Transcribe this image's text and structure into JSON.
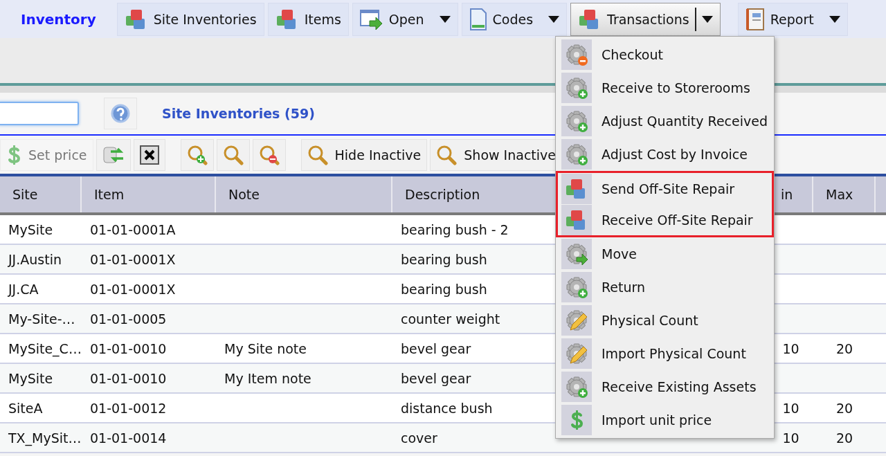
{
  "app_title": "Inventory",
  "nav": [
    {
      "label": "Site Inventories",
      "kind": "blocks",
      "dropdown": false,
      "open": false
    },
    {
      "label": "Items",
      "kind": "blocks",
      "dropdown": false,
      "open": false
    },
    {
      "label": "Open",
      "kind": "window-arrow",
      "dropdown": true,
      "open": false
    },
    {
      "label": "Codes",
      "kind": "page",
      "dropdown": true,
      "open": false
    },
    {
      "label": "Transactions",
      "kind": "blocks",
      "dropdown": true,
      "open": true
    },
    {
      "label": "Report",
      "kind": "notebook",
      "dropdown": true,
      "open": false
    }
  ],
  "menu": [
    {
      "label": "Checkout",
      "kind": "gear-minus",
      "highlighted": false
    },
    {
      "label": "Receive to Storerooms",
      "kind": "gear-plus",
      "highlighted": false
    },
    {
      "label": "Adjust Quantity Received",
      "kind": "gear-plus",
      "highlighted": false
    },
    {
      "label": "Adjust Cost by Invoice",
      "kind": "gear-plus",
      "highlighted": false
    },
    {
      "label": "Send Off-Site Repair",
      "kind": "blocks",
      "highlighted": true
    },
    {
      "label": "Receive Off-Site Repair",
      "kind": "blocks",
      "highlighted": true
    },
    {
      "label": "Move",
      "kind": "gear-arrow",
      "highlighted": false
    },
    {
      "label": "Return",
      "kind": "gear-plus",
      "highlighted": false
    },
    {
      "label": "Physical Count",
      "kind": "gear-pencil",
      "highlighted": false
    },
    {
      "label": "Import Physical Count",
      "kind": "gear-pencil",
      "highlighted": false
    },
    {
      "label": "Receive Existing Assets",
      "kind": "gear-plus",
      "highlighted": false
    },
    {
      "label": "Import unit price",
      "kind": "dollar",
      "highlighted": false
    }
  ],
  "list_title": "Site Inventories (59)",
  "toolbar_groups": [
    {
      "buttons": [
        {
          "kind": "dollar",
          "label": "Set price",
          "disabled": true
        },
        {
          "kind": "refresh",
          "disabled": false
        },
        {
          "kind": "close-box",
          "disabled": false
        }
      ]
    },
    {
      "buttons": [
        {
          "kind": "zoom-plus",
          "disabled": false
        },
        {
          "kind": "zoom",
          "disabled": false
        },
        {
          "kind": "zoom-minus",
          "disabled": false
        }
      ]
    },
    {
      "buttons": [
        {
          "kind": "zoom",
          "label": "Hide Inactive",
          "disabled": false
        },
        {
          "kind": "zoom",
          "label": "Show Inactive",
          "disabled": false
        }
      ]
    }
  ],
  "table": {
    "columns": [
      "Site",
      "Item",
      "Note",
      "Description",
      "in",
      "Max"
    ],
    "rows": [
      [
        "MySite",
        "01-01-0001A",
        "",
        "bearing bush - 2",
        "",
        ""
      ],
      [
        "JJ.Austin",
        "01-01-0001X",
        "",
        "bearing bush",
        "",
        ""
      ],
      [
        "JJ.CA",
        "01-01-0001X",
        "",
        "bearing bush",
        "",
        ""
      ],
      [
        "My-Site-…",
        "01-01-0005",
        "",
        "counter weight",
        "",
        ""
      ],
      [
        "MySite_C…",
        "01-01-0010",
        "My Site note",
        "bevel gear",
        "10",
        "20"
      ],
      [
        "MySite",
        "01-01-0010",
        "My Item note",
        "bevel gear",
        "",
        ""
      ],
      [
        "SiteA",
        "01-01-0012",
        "",
        "distance bush",
        "10",
        "20"
      ],
      [
        "TX_MySit…",
        "01-01-0014",
        "",
        "cover",
        "10",
        "20"
      ]
    ]
  }
}
